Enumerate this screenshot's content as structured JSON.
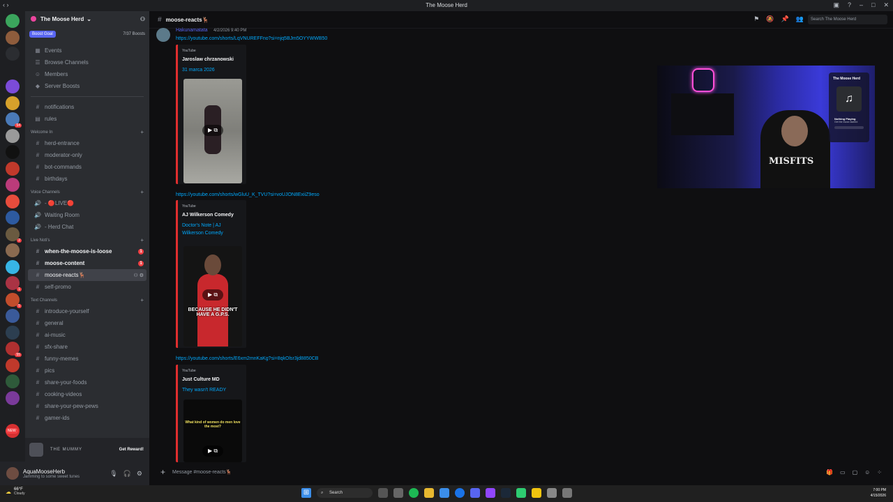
{
  "window": {
    "title": "The Moose Herd"
  },
  "server_rail": {
    "items": [
      {
        "color": "#3ba55d",
        "badge": ""
      },
      {
        "color": "#8e5c3c",
        "badge": ""
      },
      {
        "color": "#2b2d31",
        "badge": ""
      },
      {
        "color": "#1e1f22",
        "badge": ""
      },
      {
        "color": "#7b4bd8",
        "badge": ""
      },
      {
        "color": "#d6a12b",
        "badge": ""
      },
      {
        "color": "#4a7ab8",
        "badge": "54"
      },
      {
        "color": "#9a9a9a",
        "badge": ""
      },
      {
        "color": "#111111",
        "badge": ""
      },
      {
        "color": "#c0392b",
        "badge": ""
      },
      {
        "color": "#bb3b7a",
        "badge": ""
      },
      {
        "color": "#e74c3c",
        "badge": ""
      },
      {
        "color": "#2d5aa0",
        "badge": ""
      },
      {
        "color": "#6a5a40",
        "badge": "2"
      },
      {
        "color": "#8a6a50",
        "badge": ""
      },
      {
        "color": "#37b5e6",
        "badge": ""
      },
      {
        "color": "#aa3344",
        "badge": "1"
      },
      {
        "color": "#c24d2c",
        "badge": "5"
      },
      {
        "color": "#3a5a9a",
        "badge": ""
      },
      {
        "color": "#2c3e50",
        "badge": ""
      },
      {
        "color": "#b03030",
        "badge": "55"
      },
      {
        "color": "#c0392b",
        "badge": ""
      },
      {
        "color": "#2e5a3a",
        "badge": ""
      },
      {
        "color": "#7a3a9a",
        "badge": ""
      },
      {
        "color": "#1e1f22",
        "badge": ""
      },
      {
        "color": "#d63031",
        "badge": ""
      }
    ],
    "new_label": "NEW"
  },
  "guild": {
    "name": "The Moose Herd",
    "boost_goal": "Boost Goal",
    "boost_count": "7/37 Boosts",
    "top_items": [
      {
        "icon": "calendar-icon",
        "glyph": "▦",
        "label": "Events"
      },
      {
        "icon": "browse-icon",
        "glyph": "☰",
        "label": "Browse Channels"
      },
      {
        "icon": "members-icon",
        "glyph": "☺",
        "label": "Members"
      },
      {
        "icon": "boost-icon",
        "glyph": "◆",
        "label": "Server Boosts"
      }
    ],
    "info_channels": [
      {
        "glyph": "#",
        "label": "notifications"
      },
      {
        "glyph": "▤",
        "label": "rules"
      }
    ],
    "categories": [
      {
        "name": "Welcome In",
        "channels": [
          {
            "glyph": "#",
            "label": "herd-entrance",
            "unread": false
          },
          {
            "glyph": "#",
            "label": "moderator-only",
            "unread": false
          },
          {
            "glyph": "#",
            "label": "bot-commands",
            "unread": false
          },
          {
            "glyph": "#",
            "label": "birthdays",
            "unread": false
          }
        ]
      },
      {
        "name": "Voice Channels",
        "channels": [
          {
            "glyph": "🔊",
            "label": "- 🔴LIVE🔴",
            "unread": false
          },
          {
            "glyph": "🔊",
            "label": "Waiting Room",
            "unread": false
          },
          {
            "glyph": "🔊",
            "label": "- Herd Chat",
            "unread": false
          }
        ]
      },
      {
        "name": "Live Noti's",
        "channels": [
          {
            "glyph": "#",
            "label": "when-the-moose-is-loose",
            "unread": true,
            "mention": "1"
          },
          {
            "glyph": "#",
            "label": "moose-content",
            "unread": true,
            "mention": "1"
          },
          {
            "glyph": "#",
            "label": "moose-reacts🦌",
            "active": true
          },
          {
            "glyph": "#",
            "label": "self-promo",
            "unread": false
          }
        ]
      },
      {
        "name": "Text Channels",
        "channels": [
          {
            "glyph": "#",
            "label": "introduce-yourself"
          },
          {
            "glyph": "#",
            "label": "general"
          },
          {
            "glyph": "#",
            "label": "ai-music"
          },
          {
            "glyph": "#",
            "label": "sfx-share"
          },
          {
            "glyph": "#",
            "label": "funny-memes"
          },
          {
            "glyph": "#",
            "label": "pics"
          },
          {
            "glyph": "#",
            "label": "share-your-foods"
          },
          {
            "glyph": "#",
            "label": "cooking-videos"
          },
          {
            "glyph": "#",
            "label": "share-your-pew-pews"
          },
          {
            "glyph": "#",
            "label": "gamer-ids"
          }
        ]
      }
    ],
    "promo": {
      "text": "THE MUMMY",
      "button": "Get Reward!"
    }
  },
  "user": {
    "name": "AquaMooseHerb",
    "status": "Jamming to some sweet tunes"
  },
  "channel": {
    "name": "moose-reacts🦌",
    "search_placeholder": "Search The Moose Herd"
  },
  "message": {
    "author": "Hakunamatata",
    "timestamp": "4/2/2026 9:40 PM",
    "links": [
      "https://youtube.com/shorts/LqVNUREFFno?si=njq5BJm5OYYWWB50",
      "https://youtube.com/shorts/wGluU_K_TVU?si=voUJON8ExiiZ9eso",
      "https://youtube.com/shorts/E6xm2mnKaKg?si=8qkOlsr3jd8850CB"
    ],
    "embeds": [
      {
        "provider": "YouTube",
        "author": "Jaroslaw chrzanowski",
        "title": "31 marca 2026",
        "caption": ""
      },
      {
        "provider": "YouTube",
        "author": "AJ Wilkerson Comedy",
        "title": "Doctor's Note | AJ Wilkerson Comedy",
        "caption": "BECAUSE HE DIDN'T HAVE A G.P.S."
      },
      {
        "provider": "YouTube",
        "author": "Just Culture MD",
        "title": "They wasn't READY",
        "caption": "What kind of women do men love the most?"
      }
    ]
  },
  "stream_overlay": {
    "widget_title": "The Moose Herd",
    "now_playing": "Nothing Playing",
    "now_playing_sub": "Get the music started",
    "shirt_text": "MISFITS"
  },
  "composer": {
    "placeholder": "Message #moose-reacts🦌"
  },
  "taskbar": {
    "temp": "66°F",
    "weather": "Cloudy",
    "search": "Search",
    "time": "7:00 PM",
    "date": "4/15/2026"
  }
}
